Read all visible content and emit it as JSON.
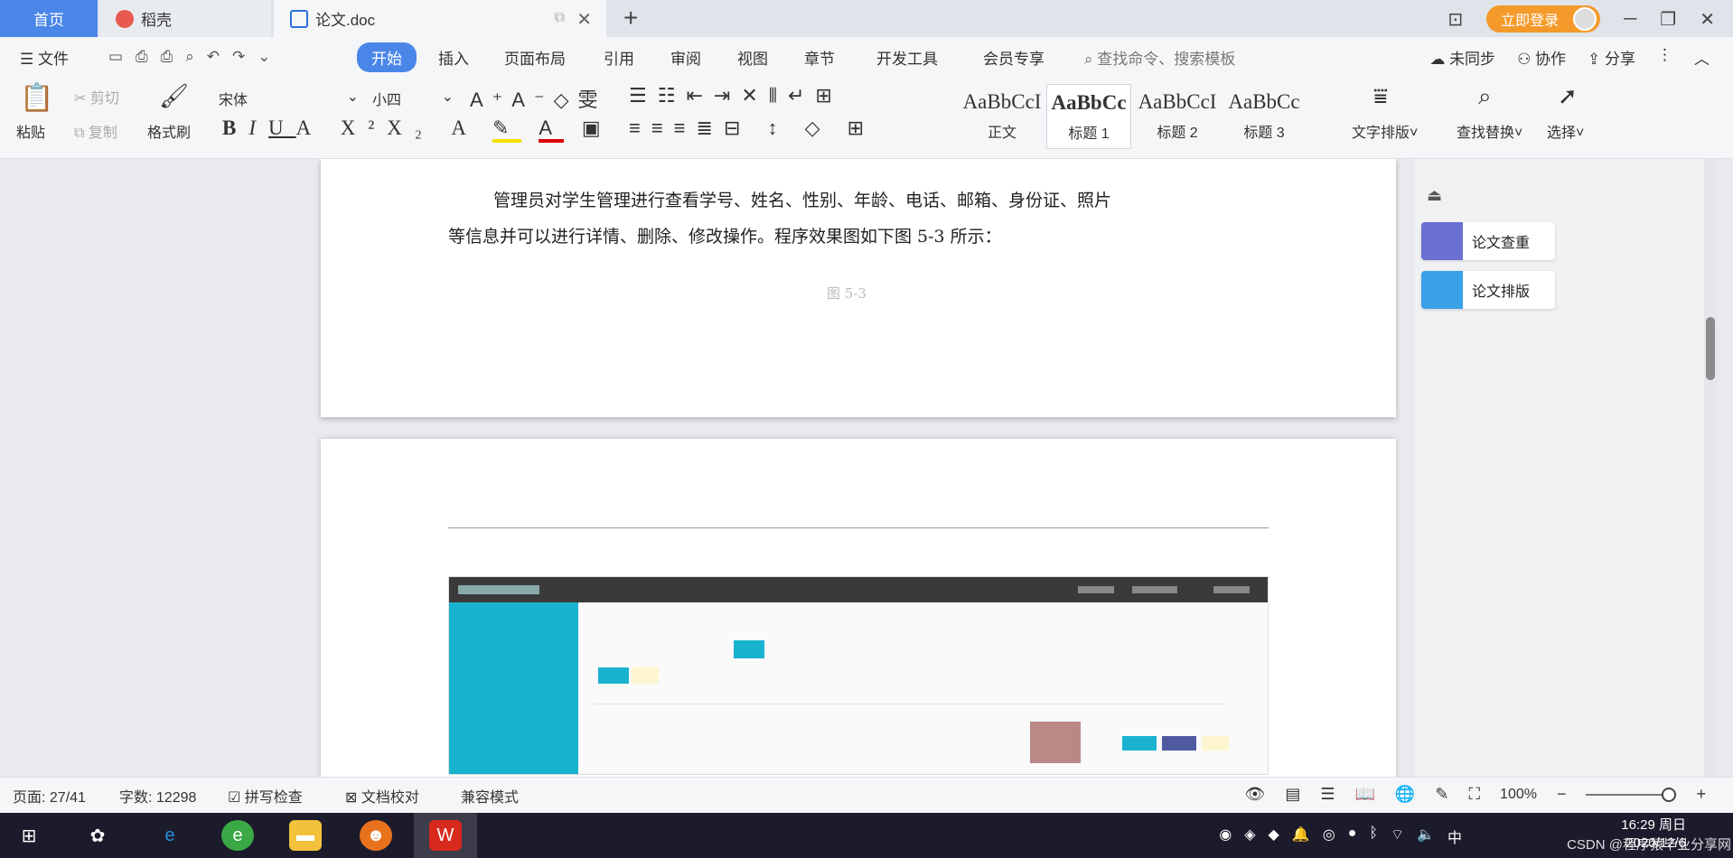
{
  "tabs": {
    "home": "首页",
    "daoke": "稻壳",
    "doc": "论文.doc",
    "login": "立即登录"
  },
  "menu": {
    "file": "文件",
    "items": [
      "开始",
      "插入",
      "页面布局",
      "引用",
      "审阅",
      "视图",
      "章节",
      "开发工具",
      "会员专享"
    ],
    "search": "查找命令、搜索模板",
    "sync": "未同步",
    "collab": "协作",
    "share": "分享"
  },
  "ribbon": {
    "paste": "粘贴",
    "cut": "剪切",
    "copy": "复制",
    "format_painter": "格式刷",
    "font": "宋体",
    "size": "小四",
    "styles": [
      {
        "sample": "AaBbCcI",
        "label": "正文"
      },
      {
        "sample": "AaBbCc",
        "label": "标题 1"
      },
      {
        "sample": "AaBbCcI",
        "label": "标题 2"
      },
      {
        "sample": "AaBbCc",
        "label": "标题 3"
      }
    ],
    "text_layout": "文字排版",
    "find_replace": "查找替换",
    "select": "选择"
  },
  "document": {
    "para_line1": "管理员对学生管理进行查看学号、姓名、性别、年龄、电话、邮箱、身份证、照片",
    "para_line2": "等信息并可以进行详情、删除、修改操作。程序效果图如下图 5-3 所示：",
    "faint_label": "图 5-3"
  },
  "panel": {
    "check": "论文查重",
    "layout": "论文排版"
  },
  "status": {
    "page": "页面: 27/41",
    "words": "字数: 12298",
    "spell": "拼写检查",
    "proof": "文档校对",
    "mode": "兼容模式",
    "zoom": "100%"
  },
  "taskbar": {
    "time": "16:29 周日",
    "date": "2020/12/6",
    "ime": "中",
    "watermark": "CSDN @程序猿毕业分享网"
  },
  "colors": {
    "accent": "#4a86e8",
    "orange": "#f49a2b",
    "teal": "#19b3cf"
  }
}
